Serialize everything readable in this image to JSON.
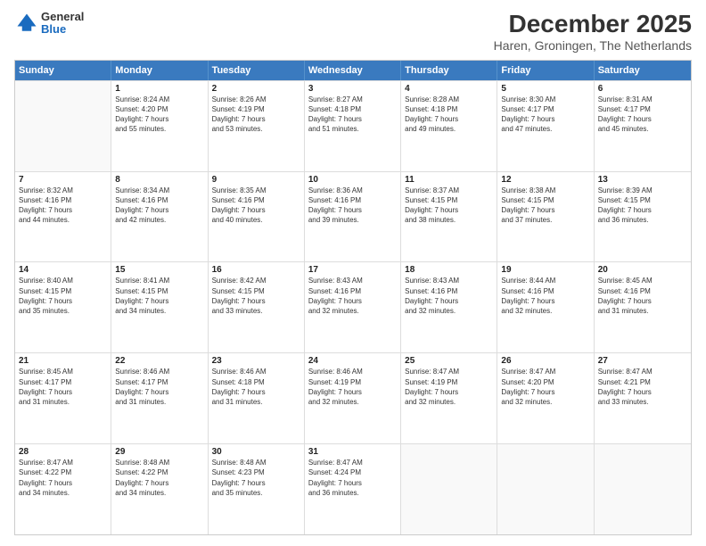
{
  "header": {
    "logo_general": "General",
    "logo_blue": "Blue",
    "title": "December 2025",
    "subtitle": "Haren, Groningen, The Netherlands"
  },
  "calendar": {
    "days": [
      "Sunday",
      "Monday",
      "Tuesday",
      "Wednesday",
      "Thursday",
      "Friday",
      "Saturday"
    ],
    "rows": [
      [
        {
          "day": "",
          "content": ""
        },
        {
          "day": "1",
          "content": "Sunrise: 8:24 AM\nSunset: 4:20 PM\nDaylight: 7 hours\nand 55 minutes."
        },
        {
          "day": "2",
          "content": "Sunrise: 8:26 AM\nSunset: 4:19 PM\nDaylight: 7 hours\nand 53 minutes."
        },
        {
          "day": "3",
          "content": "Sunrise: 8:27 AM\nSunset: 4:18 PM\nDaylight: 7 hours\nand 51 minutes."
        },
        {
          "day": "4",
          "content": "Sunrise: 8:28 AM\nSunset: 4:18 PM\nDaylight: 7 hours\nand 49 minutes."
        },
        {
          "day": "5",
          "content": "Sunrise: 8:30 AM\nSunset: 4:17 PM\nDaylight: 7 hours\nand 47 minutes."
        },
        {
          "day": "6",
          "content": "Sunrise: 8:31 AM\nSunset: 4:17 PM\nDaylight: 7 hours\nand 45 minutes."
        }
      ],
      [
        {
          "day": "7",
          "content": "Sunrise: 8:32 AM\nSunset: 4:16 PM\nDaylight: 7 hours\nand 44 minutes."
        },
        {
          "day": "8",
          "content": "Sunrise: 8:34 AM\nSunset: 4:16 PM\nDaylight: 7 hours\nand 42 minutes."
        },
        {
          "day": "9",
          "content": "Sunrise: 8:35 AM\nSunset: 4:16 PM\nDaylight: 7 hours\nand 40 minutes."
        },
        {
          "day": "10",
          "content": "Sunrise: 8:36 AM\nSunset: 4:16 PM\nDaylight: 7 hours\nand 39 minutes."
        },
        {
          "day": "11",
          "content": "Sunrise: 8:37 AM\nSunset: 4:15 PM\nDaylight: 7 hours\nand 38 minutes."
        },
        {
          "day": "12",
          "content": "Sunrise: 8:38 AM\nSunset: 4:15 PM\nDaylight: 7 hours\nand 37 minutes."
        },
        {
          "day": "13",
          "content": "Sunrise: 8:39 AM\nSunset: 4:15 PM\nDaylight: 7 hours\nand 36 minutes."
        }
      ],
      [
        {
          "day": "14",
          "content": "Sunrise: 8:40 AM\nSunset: 4:15 PM\nDaylight: 7 hours\nand 35 minutes."
        },
        {
          "day": "15",
          "content": "Sunrise: 8:41 AM\nSunset: 4:15 PM\nDaylight: 7 hours\nand 34 minutes."
        },
        {
          "day": "16",
          "content": "Sunrise: 8:42 AM\nSunset: 4:15 PM\nDaylight: 7 hours\nand 33 minutes."
        },
        {
          "day": "17",
          "content": "Sunrise: 8:43 AM\nSunset: 4:16 PM\nDaylight: 7 hours\nand 32 minutes."
        },
        {
          "day": "18",
          "content": "Sunrise: 8:43 AM\nSunset: 4:16 PM\nDaylight: 7 hours\nand 32 minutes."
        },
        {
          "day": "19",
          "content": "Sunrise: 8:44 AM\nSunset: 4:16 PM\nDaylight: 7 hours\nand 32 minutes."
        },
        {
          "day": "20",
          "content": "Sunrise: 8:45 AM\nSunset: 4:16 PM\nDaylight: 7 hours\nand 31 minutes."
        }
      ],
      [
        {
          "day": "21",
          "content": "Sunrise: 8:45 AM\nSunset: 4:17 PM\nDaylight: 7 hours\nand 31 minutes."
        },
        {
          "day": "22",
          "content": "Sunrise: 8:46 AM\nSunset: 4:17 PM\nDaylight: 7 hours\nand 31 minutes."
        },
        {
          "day": "23",
          "content": "Sunrise: 8:46 AM\nSunset: 4:18 PM\nDaylight: 7 hours\nand 31 minutes."
        },
        {
          "day": "24",
          "content": "Sunrise: 8:46 AM\nSunset: 4:19 PM\nDaylight: 7 hours\nand 32 minutes."
        },
        {
          "day": "25",
          "content": "Sunrise: 8:47 AM\nSunset: 4:19 PM\nDaylight: 7 hours\nand 32 minutes."
        },
        {
          "day": "26",
          "content": "Sunrise: 8:47 AM\nSunset: 4:20 PM\nDaylight: 7 hours\nand 32 minutes."
        },
        {
          "day": "27",
          "content": "Sunrise: 8:47 AM\nSunset: 4:21 PM\nDaylight: 7 hours\nand 33 minutes."
        }
      ],
      [
        {
          "day": "28",
          "content": "Sunrise: 8:47 AM\nSunset: 4:22 PM\nDaylight: 7 hours\nand 34 minutes."
        },
        {
          "day": "29",
          "content": "Sunrise: 8:48 AM\nSunset: 4:22 PM\nDaylight: 7 hours\nand 34 minutes."
        },
        {
          "day": "30",
          "content": "Sunrise: 8:48 AM\nSunset: 4:23 PM\nDaylight: 7 hours\nand 35 minutes."
        },
        {
          "day": "31",
          "content": "Sunrise: 8:47 AM\nSunset: 4:24 PM\nDaylight: 7 hours\nand 36 minutes."
        },
        {
          "day": "",
          "content": ""
        },
        {
          "day": "",
          "content": ""
        },
        {
          "day": "",
          "content": ""
        }
      ]
    ]
  }
}
